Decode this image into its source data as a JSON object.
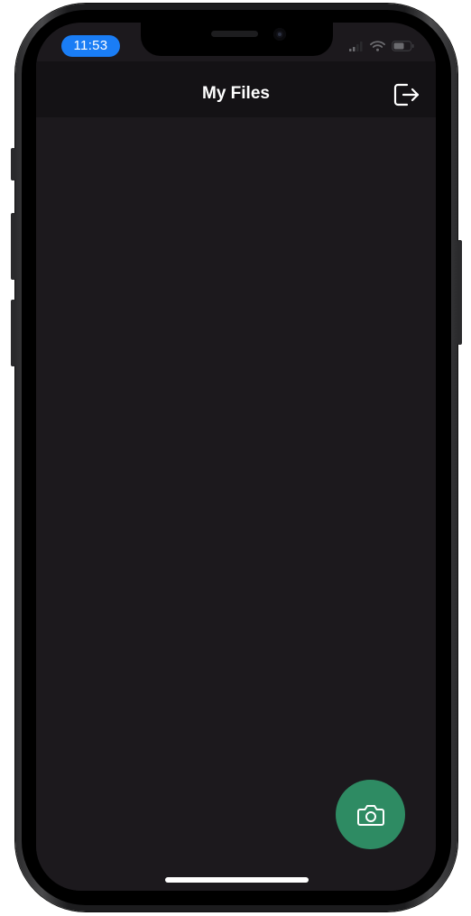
{
  "status_bar": {
    "time": "11:53",
    "time_pill_color": "#1a7df5",
    "icons": [
      "cellular-signal-icon",
      "wifi-icon",
      "battery-icon"
    ]
  },
  "header": {
    "title": "My Files",
    "logout_icon": "logout-icon"
  },
  "fab": {
    "icon": "camera-icon",
    "color": "#2e8b63"
  },
  "colors": {
    "screen_background": "#1c191d",
    "header_background": "#141215"
  }
}
